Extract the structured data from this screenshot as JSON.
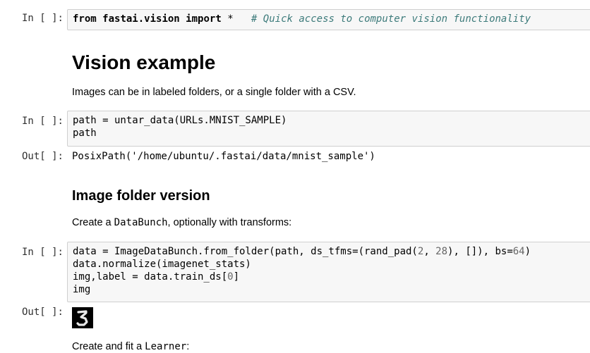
{
  "cells": {
    "c1": {
      "prompt": "In [ ]:",
      "code": {
        "kw_from": "from",
        "module": "fastai.vision",
        "kw_import": "import",
        "star": "*",
        "comment": "# Quick access to computer vision functionality"
      }
    },
    "md1": {
      "heading": "Vision example",
      "text": "Images can be in labeled folders, or a single folder with a CSV."
    },
    "c2": {
      "prompt": "In [ ]:",
      "line1": "path = untar_data(URLs.MNIST_SAMPLE)",
      "line2": "path",
      "out_prompt": "Out[ ]:",
      "output": "PosixPath('/home/ubuntu/.fastai/data/mnist_sample')"
    },
    "md2": {
      "heading": "Image folder version",
      "text_before": "Create a ",
      "code_word": "DataBunch",
      "text_after": ", optionally with transforms:"
    },
    "c3": {
      "prompt": "In [ ]:",
      "line1_a": "data = ImageDataBunch.from_folder(path, ds_tfms=(rand_pad(",
      "num_2": "2",
      "line1_b": ", ",
      "num_28": "28",
      "line1_c": "), []), bs=",
      "num_64": "64",
      "line1_d": ")",
      "line2": "data.normalize(imagenet_stats)",
      "line3_a": "img,label = data.train_ds[",
      "num_0": "0",
      "line3_b": "]",
      "line4": "img",
      "out_prompt": "Out[ ]:"
    },
    "md3": {
      "text_before": "Create and fit a ",
      "code_word": "Learner",
      "text_after": ":"
    }
  }
}
